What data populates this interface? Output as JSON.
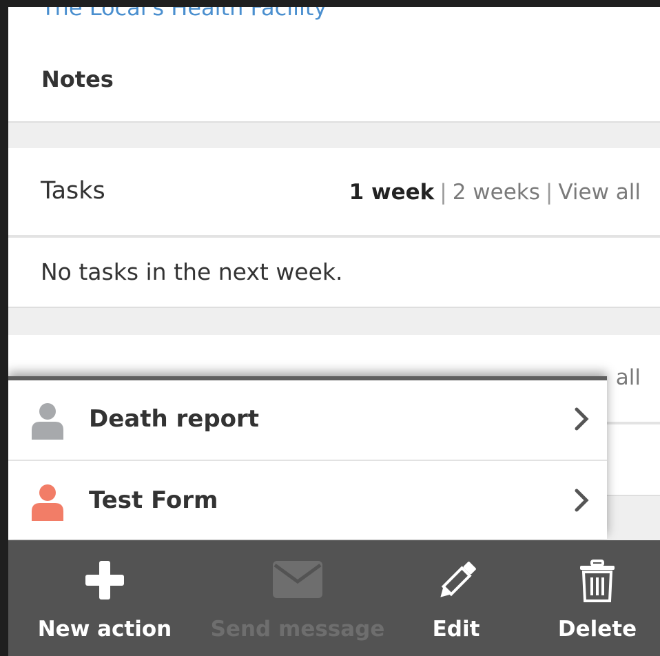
{
  "facility": {
    "name": "The Local's Health Facility"
  },
  "notes": {
    "title": "Notes"
  },
  "tasks": {
    "title": "Tasks",
    "filters": [
      {
        "label": "1 week",
        "active": true
      },
      {
        "label": "2 weeks",
        "active": false
      },
      {
        "label": "View all",
        "active": false
      }
    ],
    "empty_text": "No tasks in the next week."
  },
  "hidden_section": {
    "partial_text": "all"
  },
  "new_action_menu": {
    "items": [
      {
        "label": "Death report",
        "icon": "person-icon",
        "icon_color": "#a7a9ac"
      },
      {
        "label": "Test Form",
        "icon": "person-icon",
        "icon_color": "#f27d67"
      }
    ]
  },
  "action_bar": {
    "items": [
      {
        "label": "New action",
        "icon": "plus-icon",
        "enabled": true
      },
      {
        "label": "Send message",
        "icon": "envelope-icon",
        "enabled": false
      },
      {
        "label": "Edit",
        "icon": "pencil-icon",
        "enabled": true
      },
      {
        "label": "Delete",
        "icon": "trash-icon",
        "enabled": true
      }
    ]
  },
  "colors": {
    "link": "#4a8fcf",
    "action_bar_bg": "#535353",
    "disabled": "#6e6e6e"
  }
}
